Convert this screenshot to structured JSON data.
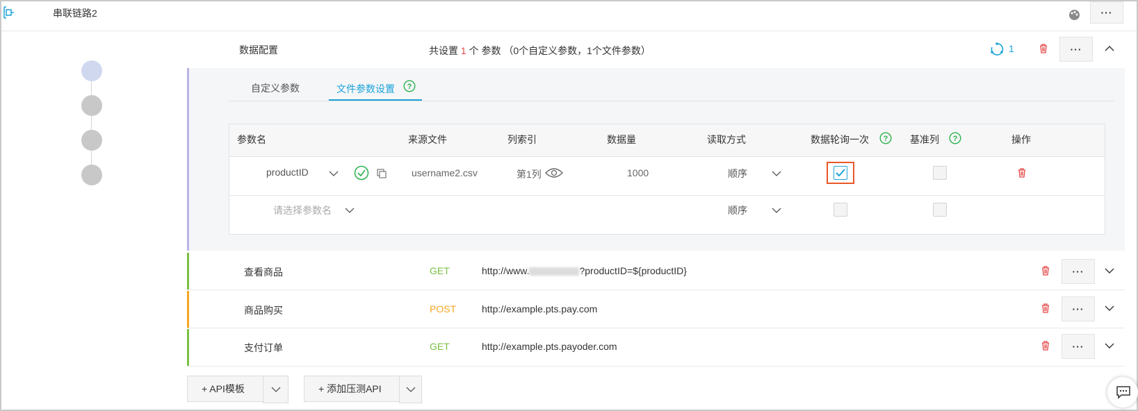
{
  "header": {
    "title": "串联链路2"
  },
  "data_config": {
    "title": "数据配置",
    "summary_prefix": "共设置",
    "summary_count": "1",
    "summary_suffix": "个 参数",
    "summary_detail": "（0个自定义参数，1个文件参数）",
    "badge_count": "1"
  },
  "tabs": [
    {
      "label": "自定义参数",
      "active": false
    },
    {
      "label": "文件参数设置",
      "active": true
    }
  ],
  "table": {
    "headers": [
      "参数名",
      "来源文件",
      "列索引",
      "数据量",
      "读取方式",
      "数据轮询一次",
      "基准列",
      "操作"
    ],
    "rows": [
      {
        "param": "productID",
        "file": "username2.csv",
        "column": "第1列",
        "count": "1000",
        "read_mode": "顺序",
        "poll_once": true,
        "base": false
      },
      {
        "param_placeholder": "请选择参数名",
        "read_mode": "顺序",
        "poll_once": false,
        "base": false
      }
    ]
  },
  "apis": [
    {
      "name": "查看商品",
      "method": "GET",
      "method_color": "#7ac143",
      "bar_color": "#7ac143",
      "url": "http://www.",
      "url_tail": "?productID=${productID}"
    },
    {
      "name": "商品购买",
      "method": "POST",
      "method_color": "#f5a623",
      "bar_color": "#f5a623",
      "url": "http://example.pts.pay.com"
    },
    {
      "name": "支付订单",
      "method": "GET",
      "method_color": "#7ac143",
      "bar_color": "#7ac143",
      "url": "http://example.pts.payoder.com"
    }
  ],
  "footer": {
    "api_template_label": "+ API模板",
    "add_api_label": "+ 添加压测API"
  },
  "colors": {
    "accent": "#1ba3d8",
    "danger": "#e64545",
    "highlight": "#e8572a",
    "config_bar": "#b8b4e8"
  }
}
